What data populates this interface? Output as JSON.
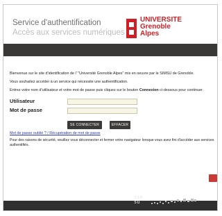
{
  "header": {
    "title_line1": "Service d'authentification",
    "title_line2": "Accès aux services numériques",
    "logo": {
      "line1": "UNIVERSITE",
      "line2": "Grenoble",
      "line3": "Alpes",
      "color": "#d21f26"
    }
  },
  "content": {
    "intro": "Bienvenue sur le site d'identification de l' \"Université Grenoble Alpes\" mis en oeuvre par le SIMSU de Grenoble.",
    "service_note": "Vous souhaitez accéder à un service qui nécessite une authentification.",
    "instructions_prefix": "Entrez votre nom d'utilisateur et votre mot de passe puis cliquez sur le bouton ",
    "instructions_bold": "Connexion",
    "instructions_suffix": " ci-dessous pour continuer.",
    "username_label": "Utilisateur",
    "password_label": "Mot de passe",
    "username_value": "",
    "password_value": "",
    "login_button": "SE CONNECTER",
    "clear_button": "EFFACER",
    "forgot_link": "Mot de passe oublié ? / Récupération de mot de passe",
    "security_note": "Pour des raisons de sécurité, veuillez vous déconnecter et fermer votre navigateur lorsque vous avez fini d'accéder aux services authentifiés."
  },
  "footer": {
    "logo_text_top": "sim",
    "logo_text_bottom": "su"
  },
  "colors": {
    "accent_red": "#d21f26",
    "bar_dark": "#393836",
    "input_bg": "#f7f5e4",
    "link": "#2b3aa8"
  }
}
